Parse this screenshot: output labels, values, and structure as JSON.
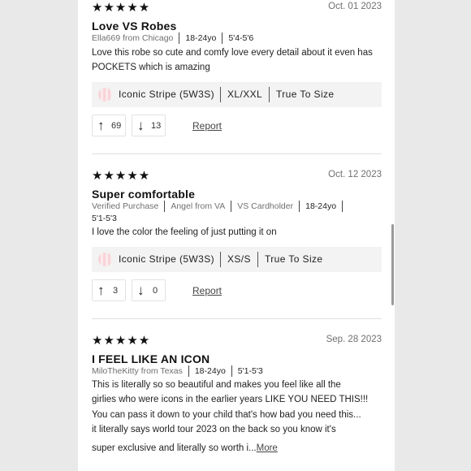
{
  "reviews": [
    {
      "rating": "★★★★★",
      "date": "Oct. 01 2023",
      "title": "Love VS Robes",
      "author": "Ella669 from Chicago",
      "age": "18-24yo",
      "height": "5'4-5'6",
      "body": "Love this robe so cute and comfy love every detail about it even has POCKETS which is amazing",
      "color": "Iconic Stripe (5W3S)",
      "size": "XL/XXL",
      "fit": "True To Size",
      "upvotes": "69",
      "downvotes": "13",
      "report": "Report"
    },
    {
      "rating": "★★★★★",
      "date": "Oct. 12 2023",
      "title": "Super comfortable",
      "verified": "Verified Purchase",
      "author": "Angel from VA",
      "badge": "VS Cardholder",
      "age": "18-24yo",
      "height": "5'1-5'3",
      "body": "I love the color the feeling of just putting it on",
      "color": "Iconic Stripe (5W3S)",
      "size": "XS/S",
      "fit": "True To Size",
      "upvotes": "3",
      "downvotes": "0",
      "report": "Report"
    },
    {
      "rating": "★★★★★",
      "date": "Sep. 28 2023",
      "title": "I FEEL LIKE AN ICON",
      "author": "MiloTheKitty from Texas",
      "age": "18-24yo",
      "height": "5'1-5'3",
      "body_lines": [
        "This is literally so so beautiful and makes you feel like all the",
        "girlies who were icons in the earlier years LIKE YOU NEED THIS!!!",
        "You can pass it down to your child that's how bad you need this...",
        "it literally says world tour 2023 on the back so you know it's"
      ],
      "body_last": "super exclusive and literally so worth i...",
      "more": "More"
    }
  ],
  "icons": {
    "upvote": "arrow-up-icon",
    "downvote": "arrow-down-icon",
    "swatch": "stripe-swatch-icon"
  },
  "colors": {
    "background": "#e9e9e9",
    "panel": "#ffffff",
    "chip_bg": "#f3f3f3",
    "text": "#1a1a1a",
    "muted": "#707070"
  }
}
